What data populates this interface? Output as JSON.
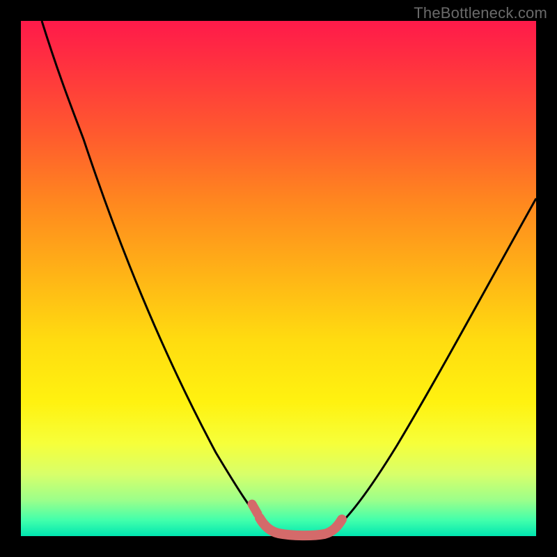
{
  "watermark": "TheBottleneck.com",
  "colors": {
    "frame": "#000000",
    "gradient_top": "#ff1a4a",
    "gradient_bottom": "#00e6b0",
    "curve": "#000000",
    "highlight": "#d46a6a"
  },
  "chart_data": {
    "type": "line",
    "title": "",
    "xlabel": "",
    "ylabel": "",
    "xlim": [
      0,
      1
    ],
    "ylim": [
      0,
      1
    ],
    "note": "Axes are unlabeled; values are normalized estimates read from pixel positions. y=1 at top of colored area, y=0 at bottom.",
    "series": [
      {
        "name": "left-curve",
        "x": [
          0.04,
          0.1,
          0.16,
          0.22,
          0.28,
          0.34,
          0.4,
          0.44,
          0.47,
          0.49
        ],
        "y": [
          1.0,
          0.83,
          0.67,
          0.51,
          0.36,
          0.22,
          0.1,
          0.04,
          0.01,
          0.0
        ]
      },
      {
        "name": "right-curve",
        "x": [
          0.6,
          0.64,
          0.7,
          0.76,
          0.82,
          0.88,
          0.94,
          1.0
        ],
        "y": [
          0.0,
          0.03,
          0.1,
          0.2,
          0.31,
          0.43,
          0.54,
          0.66
        ]
      },
      {
        "name": "bottom-highlight",
        "x": [
          0.47,
          0.5,
          0.54,
          0.58,
          0.61
        ],
        "y": [
          0.02,
          0.005,
          0.0,
          0.005,
          0.02
        ]
      }
    ]
  }
}
